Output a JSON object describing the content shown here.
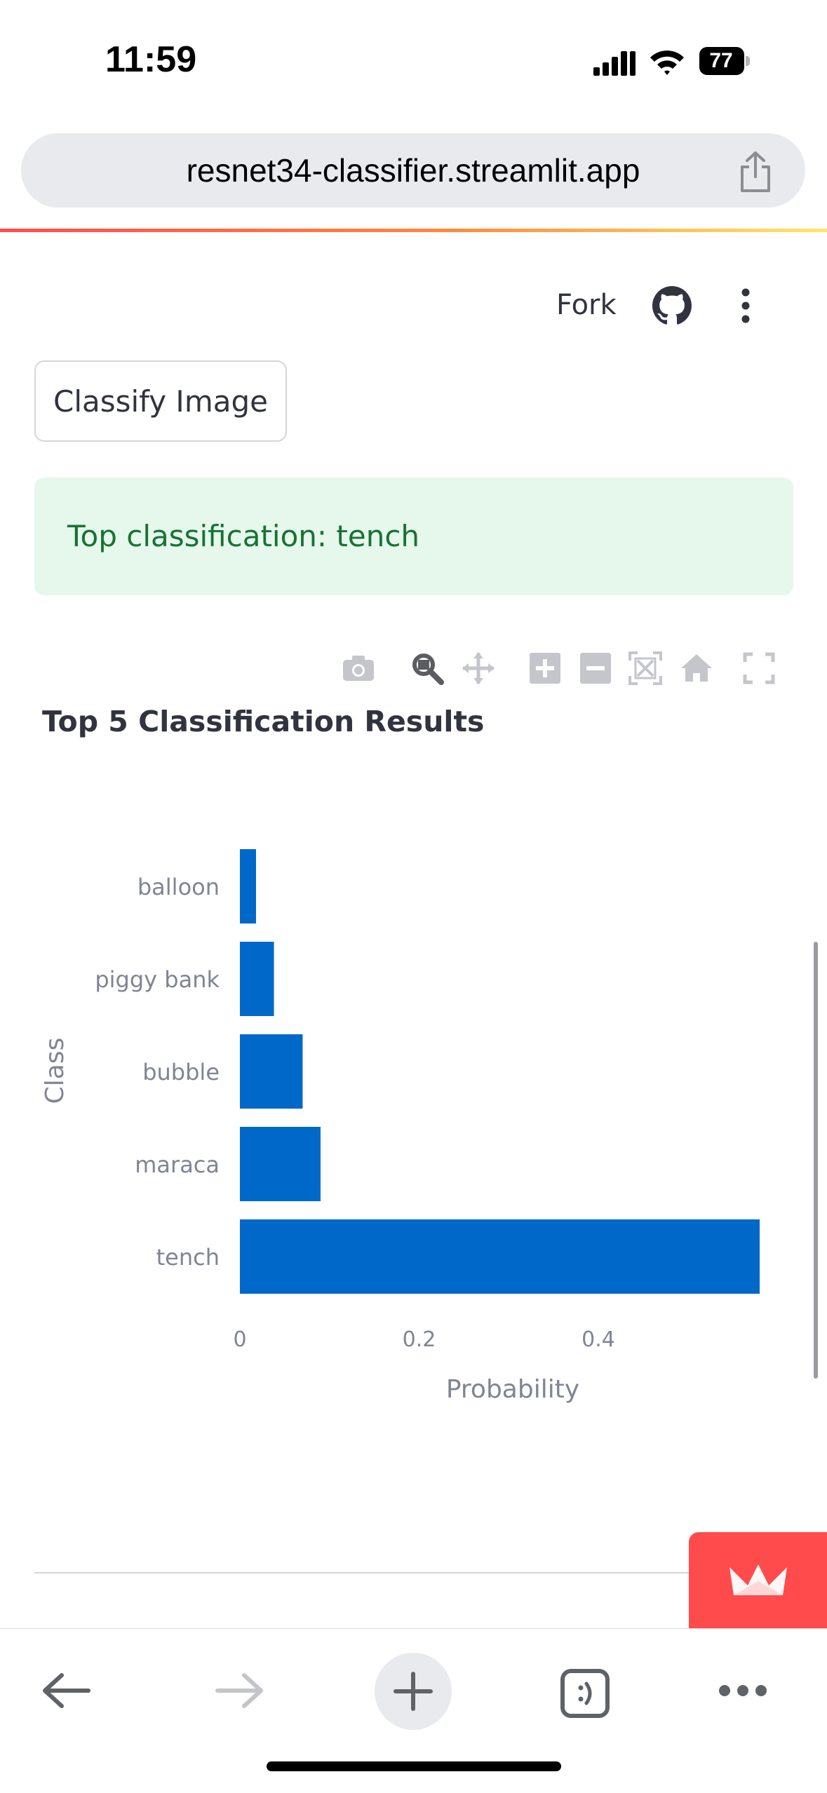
{
  "status_bar": {
    "time": "11:59",
    "battery": "77"
  },
  "browser": {
    "url": "resnet34-classifier.streamlit.app"
  },
  "header": {
    "fork_label": "Fork"
  },
  "main": {
    "classify_button": "Classify Image",
    "alert_text": "Top classification: tench"
  },
  "modebar": {
    "icons": [
      "camera-icon",
      "zoom-icon",
      "pan-icon",
      "zoom-in-icon",
      "zoom-out-icon",
      "autoscale-icon",
      "reset-axes-icon",
      "fullscreen-icon"
    ]
  },
  "chart_data": {
    "type": "bar",
    "orientation": "horizontal",
    "title": "Top 5 Classification Results",
    "xlabel": "Probability",
    "ylabel": "Class",
    "categories": [
      "tench",
      "maraca",
      "bubble",
      "piggy bank",
      "balloon"
    ],
    "values": [
      0.58,
      0.09,
      0.07,
      0.038,
      0.018
    ],
    "x_ticks": [
      0,
      0.2,
      0.4
    ],
    "x_tick_labels": [
      "0",
      "0.2",
      "0.4"
    ],
    "xlim": [
      0,
      0.58
    ],
    "bar_color": "#0068c9",
    "grid": false
  },
  "colors": {
    "success_bg": "#e6f7ec",
    "success_text": "#177233",
    "streamlit_red": "#ff4b4b",
    "bar": "#0068c9"
  }
}
